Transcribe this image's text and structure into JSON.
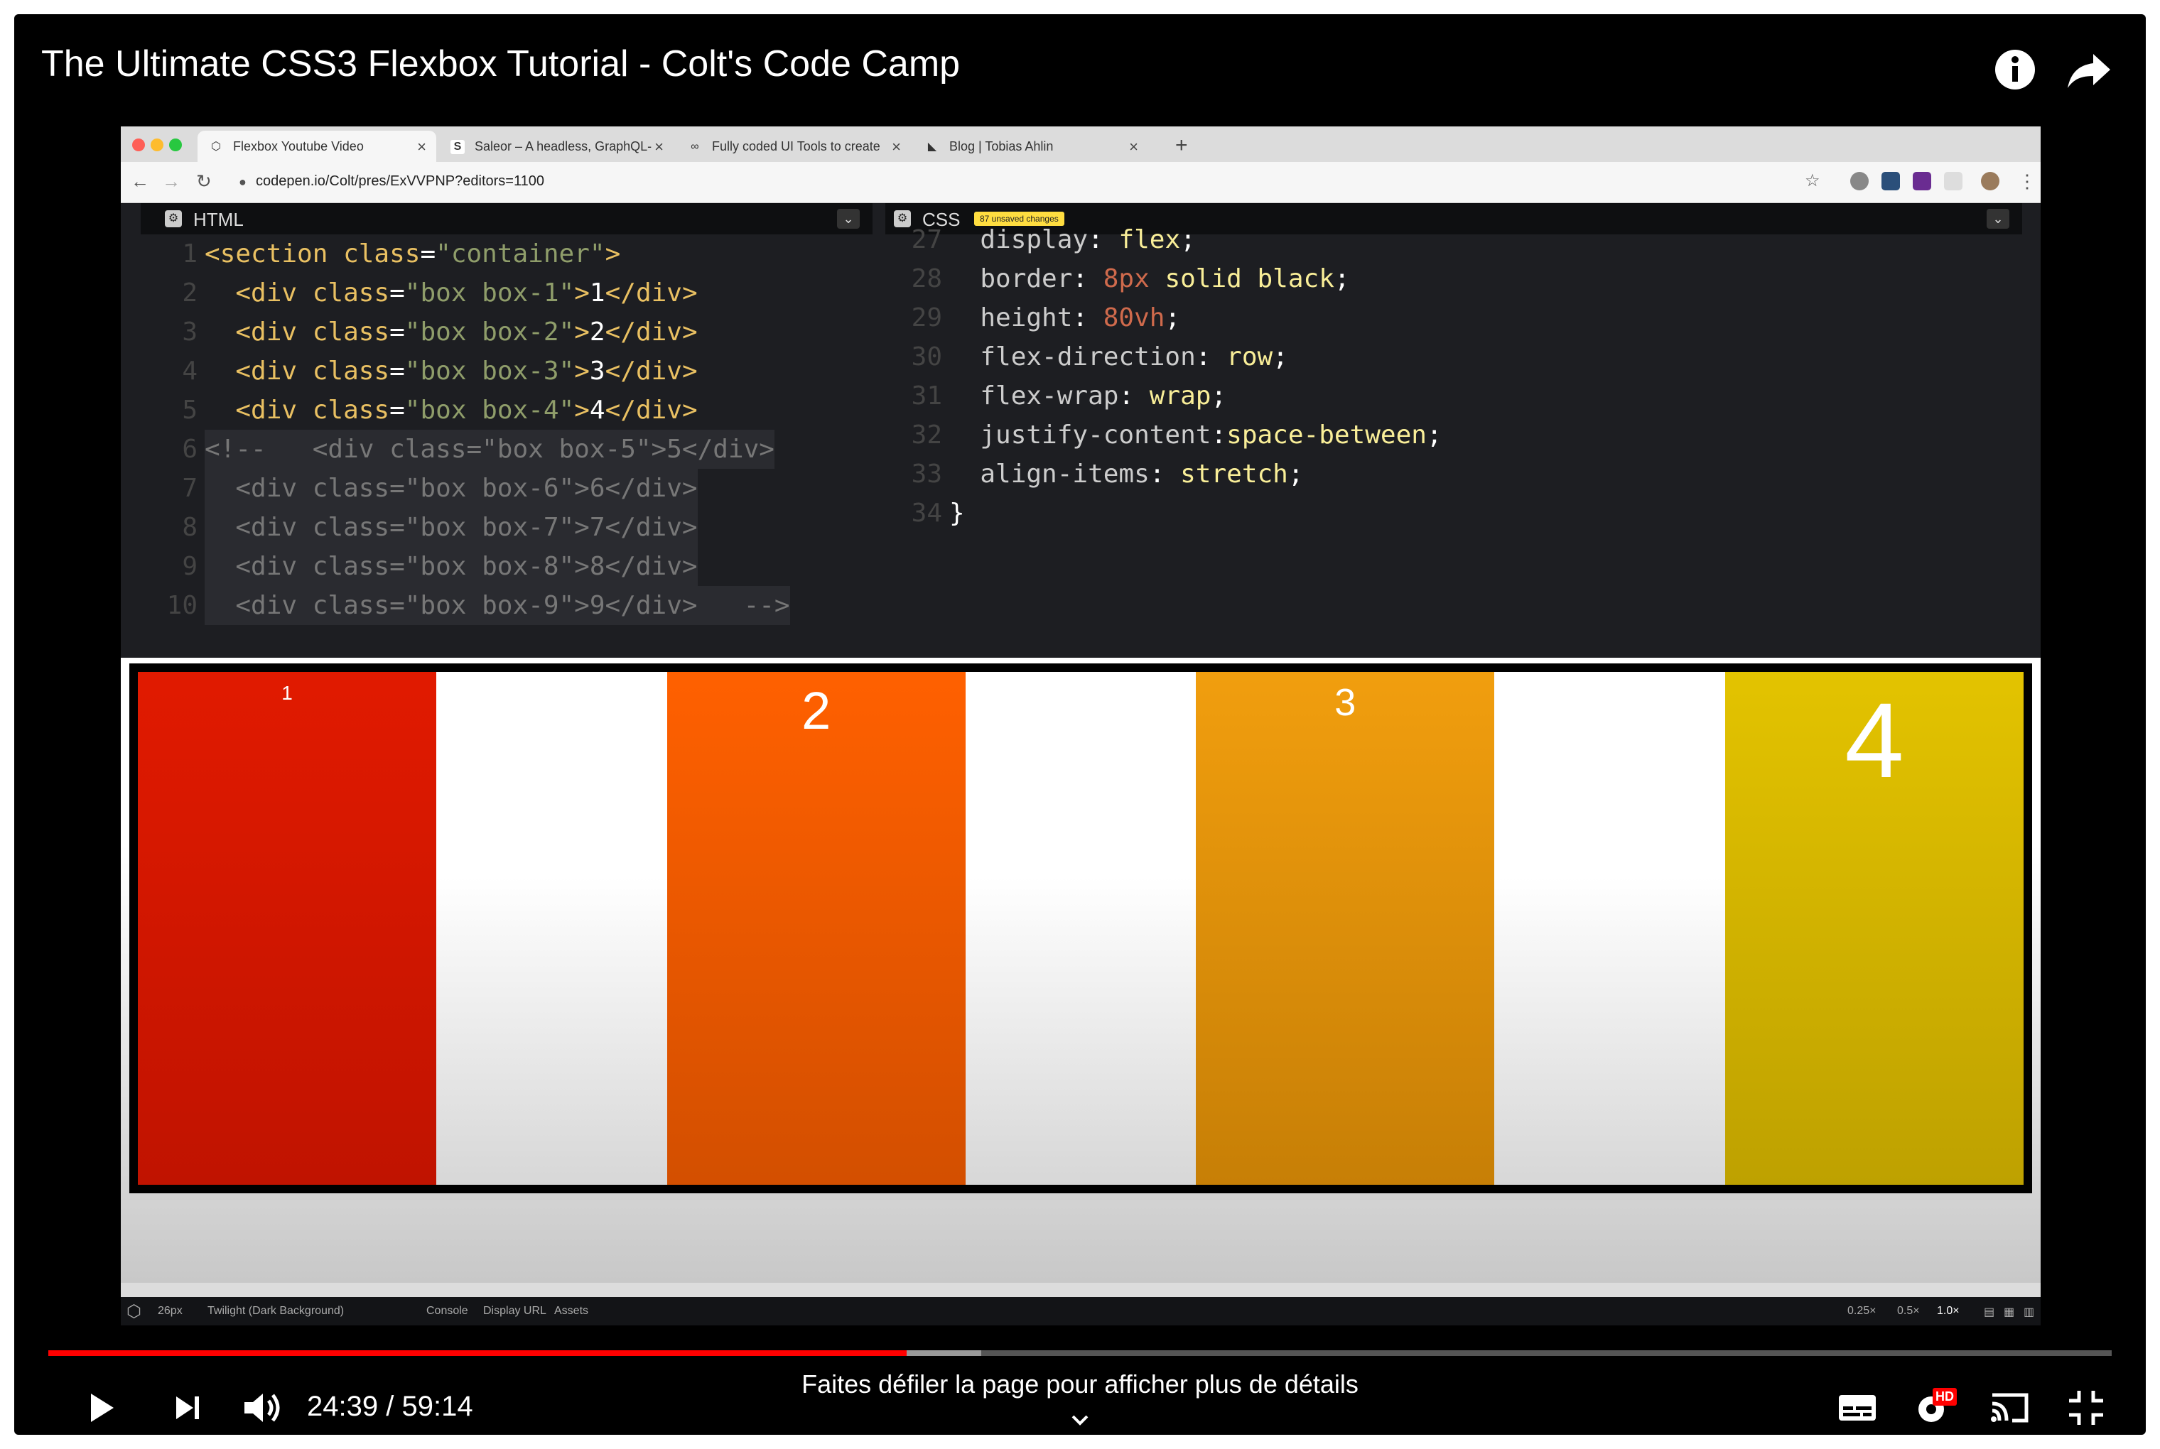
{
  "video": {
    "title": "The Ultimate CSS3 Flexbox Tutorial - Colt's Code Camp",
    "time_current": "24:39",
    "time_separator": "/",
    "time_total": "59:14",
    "progress_played": 0.416,
    "progress_buffered": 0.452,
    "scroll_hint": "Faites défiler la page pour afficher plus de détails",
    "hd_badge": "HD"
  },
  "browser": {
    "tabs": [
      {
        "label": "Flexbox Youtube Video",
        "favicon": "codepen-icon"
      },
      {
        "label": "Saleor – A headless, GraphQL-",
        "favicon": "S"
      },
      {
        "label": "Fully coded UI Tools to create",
        "favicon": "infinity-icon"
      },
      {
        "label": "Blog | Tobias Ahlin",
        "favicon": "ta-logo-icon"
      }
    ],
    "url": "codepen.io/Colt/pres/ExVVPNP?editors=1100"
  },
  "html_editor": {
    "label": "HTML",
    "lines": [
      {
        "n": "1",
        "parts": [
          [
            "tag",
            "<section "
          ],
          [
            "attr",
            "class"
          ],
          [
            "txt",
            "="
          ],
          [
            "str",
            "\"container\""
          ],
          [
            "tag",
            ">"
          ]
        ]
      },
      {
        "n": "2",
        "parts": [
          [
            "txt",
            "  "
          ],
          [
            "tag",
            "<div "
          ],
          [
            "attr",
            "class"
          ],
          [
            "txt",
            "="
          ],
          [
            "str",
            "\"box box-1\""
          ],
          [
            "tag",
            ">"
          ],
          [
            "txt",
            "1"
          ],
          [
            "tag",
            "</div>"
          ]
        ]
      },
      {
        "n": "3",
        "parts": [
          [
            "txt",
            "  "
          ],
          [
            "tag",
            "<div "
          ],
          [
            "attr",
            "class"
          ],
          [
            "txt",
            "="
          ],
          [
            "str",
            "\"box box-2\""
          ],
          [
            "tag",
            ">"
          ],
          [
            "txt",
            "2"
          ],
          [
            "tag",
            "</div>"
          ]
        ]
      },
      {
        "n": "4",
        "parts": [
          [
            "txt",
            "  "
          ],
          [
            "tag",
            "<div "
          ],
          [
            "attr",
            "class"
          ],
          [
            "txt",
            "="
          ],
          [
            "str",
            "\"box box-3\""
          ],
          [
            "tag",
            ">"
          ],
          [
            "txt",
            "3"
          ],
          [
            "tag",
            "</div>"
          ]
        ]
      },
      {
        "n": "5",
        "parts": [
          [
            "txt",
            "  "
          ],
          [
            "tag",
            "<div "
          ],
          [
            "attr",
            "class"
          ],
          [
            "txt",
            "="
          ],
          [
            "str",
            "\"box box-4\""
          ],
          [
            "tag",
            ">"
          ],
          [
            "txt",
            "4"
          ],
          [
            "tag",
            "</div>"
          ]
        ]
      },
      {
        "n": "6",
        "parts": [
          [
            "cmt",
            "<!--   <div class=\"box box-5\">5</div>"
          ]
        ]
      },
      {
        "n": "7",
        "parts": [
          [
            "cmt",
            "  <div class=\"box box-6\">6</div>"
          ]
        ]
      },
      {
        "n": "8",
        "parts": [
          [
            "cmt",
            "  <div class=\"box box-7\">7</div>"
          ]
        ]
      },
      {
        "n": "9",
        "parts": [
          [
            "cmt",
            "  <div class=\"box box-8\">8</div>"
          ]
        ]
      },
      {
        "n": "10",
        "parts": [
          [
            "cmt",
            "  <div class=\"box box-9\">9</div>   -->"
          ]
        ]
      }
    ]
  },
  "css_editor": {
    "label": "CSS",
    "badge": "87 unsaved changes",
    "lines": [
      {
        "n": "27",
        "parts": [
          [
            "prop",
            "  display"
          ],
          [
            "txt",
            ": "
          ],
          [
            "val",
            "flex"
          ],
          [
            "txt",
            ";"
          ]
        ]
      },
      {
        "n": "28",
        "parts": [
          [
            "prop",
            "  border"
          ],
          [
            "txt",
            ": "
          ],
          [
            "num",
            "8px"
          ],
          [
            "val",
            " solid black"
          ],
          [
            "txt",
            ";"
          ]
        ]
      },
      {
        "n": "29",
        "parts": [
          [
            "prop",
            "  height"
          ],
          [
            "txt",
            ": "
          ],
          [
            "num",
            "80vh"
          ],
          [
            "txt",
            ";"
          ]
        ]
      },
      {
        "n": "30",
        "parts": [
          [
            "prop",
            "  flex-direction"
          ],
          [
            "txt",
            ": "
          ],
          [
            "val",
            "row"
          ],
          [
            "txt",
            ";"
          ]
        ]
      },
      {
        "n": "31",
        "parts": [
          [
            "prop",
            "  flex-wrap"
          ],
          [
            "txt",
            ": "
          ],
          [
            "val",
            "wrap"
          ],
          [
            "txt",
            ";"
          ]
        ]
      },
      {
        "n": "32",
        "parts": [
          [
            "prop",
            "  justify-content"
          ],
          [
            "txt",
            ":"
          ],
          [
            "val",
            "space-between"
          ],
          [
            "txt",
            ";"
          ]
        ]
      },
      {
        "n": "33",
        "parts": [
          [
            "prop",
            "  align-items"
          ],
          [
            "txt",
            ": "
          ],
          [
            "val",
            "stretch"
          ],
          [
            "txt",
            ";"
          ]
        ]
      },
      {
        "n": "34",
        "parts": [
          [
            "txt",
            "}"
          ]
        ]
      }
    ]
  },
  "preview": {
    "boxes": [
      "1",
      "2",
      "3",
      "4"
    ]
  },
  "statusbar": {
    "font_size": "26px",
    "theme": "Twilight (Dark Background)",
    "console": "Console",
    "display_url": "Display URL",
    "assets": "Assets",
    "zoom_025": "0.25×",
    "zoom_05": "0.5×",
    "zoom_1": "1.0×"
  },
  "colors": {
    "box1": "#e11a00",
    "box2": "#ff6000",
    "box3": "#f19e0e",
    "box4": "#e3c300",
    "progress": "#ff0000"
  }
}
